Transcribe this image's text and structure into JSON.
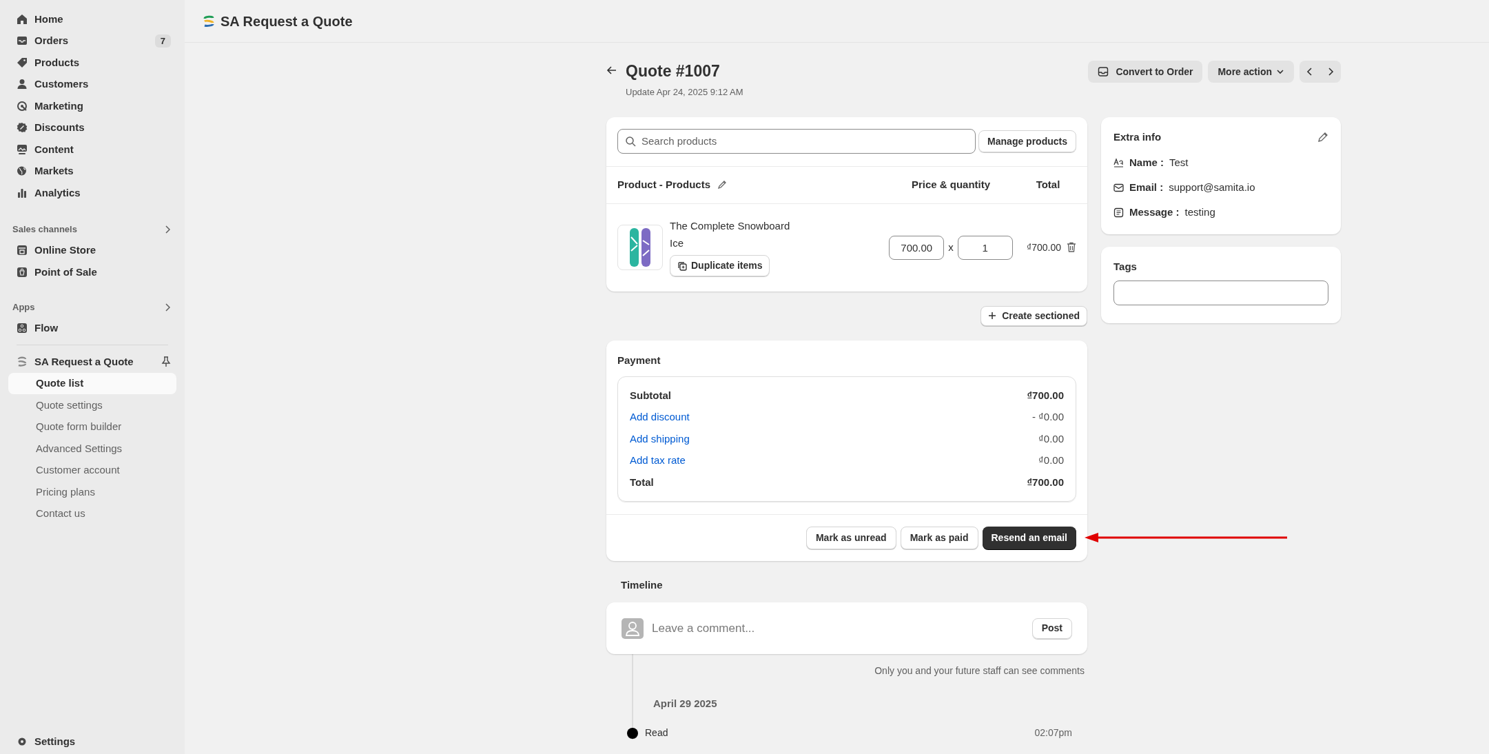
{
  "sidebar": {
    "items": [
      {
        "label": "Home"
      },
      {
        "label": "Orders",
        "badge": "7"
      },
      {
        "label": "Products"
      },
      {
        "label": "Customers"
      },
      {
        "label": "Marketing"
      },
      {
        "label": "Discounts"
      },
      {
        "label": "Content"
      },
      {
        "label": "Markets"
      },
      {
        "label": "Analytics"
      }
    ],
    "sales_channels": {
      "title": "Sales channels",
      "items": [
        {
          "label": "Online Store"
        },
        {
          "label": "Point of Sale"
        }
      ]
    },
    "apps": {
      "title": "Apps",
      "items": [
        {
          "label": "Flow"
        }
      ]
    },
    "app": {
      "title": "SA Request a Quote",
      "subitems": [
        {
          "label": "Quote list",
          "selected": true
        },
        {
          "label": "Quote settings",
          "selected": false
        },
        {
          "label": "Quote form builder",
          "selected": false
        },
        {
          "label": "Advanced Settings",
          "selected": false
        },
        {
          "label": "Customer account",
          "selected": false
        },
        {
          "label": "Pricing plans",
          "selected": false
        },
        {
          "label": "Contact us",
          "selected": false
        }
      ]
    },
    "settings": "Settings"
  },
  "header": {
    "title": "SA Request a Quote"
  },
  "quote": {
    "title": "Quote #1007",
    "updated": "Update Apr 24, 2025 9:12 AM",
    "convert": "Convert to Order",
    "more": "More action"
  },
  "products": {
    "search_placeholder": "Search products",
    "manage": "Manage products",
    "columns": [
      "Product - Products",
      "Price & quantity",
      "Total"
    ],
    "items": [
      {
        "name": "The Complete Snowboard",
        "variant": "Ice",
        "duplicate": "Duplicate items",
        "price": "700.00",
        "times": "x",
        "quantity": "1",
        "total": "₫700.00"
      }
    ],
    "create_section": "Create sectioned"
  },
  "payment": {
    "title": "Payment",
    "rows": [
      {
        "kind": "total",
        "label": "Subtotal",
        "value": "₫700.00"
      },
      {
        "kind": "link",
        "label": "Add discount",
        "value": "- ₫0.00"
      },
      {
        "kind": "link",
        "label": "Add shipping",
        "value": "₫0.00"
      },
      {
        "kind": "link",
        "label": "Add tax rate",
        "value": "₫0.00"
      },
      {
        "kind": "total",
        "label": "Total",
        "value": "₫700.00"
      }
    ],
    "actions": [
      {
        "label": "Mark as unread",
        "primary": false
      },
      {
        "label": "Mark as paid",
        "primary": false
      },
      {
        "label": "Resend an email",
        "primary": true
      }
    ]
  },
  "timeline": {
    "title": "Timeline",
    "comment_placeholder": "Leave a comment...",
    "post": "Post",
    "note": "Only you and your future staff can see comments",
    "date": "April 29 2025",
    "events": [
      {
        "label": "Read",
        "time": "02:07pm"
      }
    ]
  },
  "extra_info": {
    "title": "Extra info",
    "fields": [
      {
        "label": "Name :",
        "value": "Test"
      },
      {
        "label": "Email :",
        "value": "support@samita.io"
      },
      {
        "label": "Message :",
        "value": "testing"
      }
    ]
  },
  "tags": {
    "title": "Tags"
  }
}
